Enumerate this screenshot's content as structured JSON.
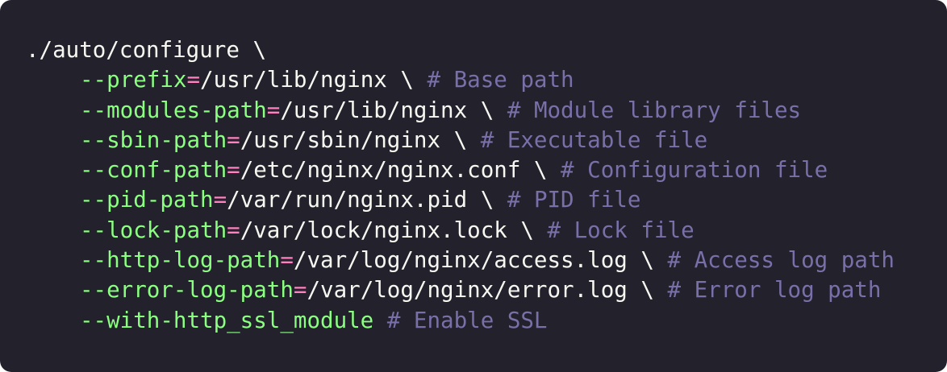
{
  "colors": {
    "background": "#22212c",
    "plain_text": "#f8f8f2",
    "flag": "#8aff80",
    "operator": "#ff80bf",
    "comment": "#7970a9"
  },
  "code": {
    "command": "./auto/configure \\",
    "options": [
      {
        "flag": "--prefix",
        "op": "=",
        "value": "/usr/lib/nginx \\ ",
        "comment": "# Base path"
      },
      {
        "flag": "--modules-path",
        "op": "=",
        "value": "/usr/lib/nginx \\ ",
        "comment": "# Module library files"
      },
      {
        "flag": "--sbin-path",
        "op": "=",
        "value": "/usr/sbin/nginx \\ ",
        "comment": "# Executable file"
      },
      {
        "flag": "--conf-path",
        "op": "=",
        "value": "/etc/nginx/nginx.conf \\ ",
        "comment": "# Configuration file"
      },
      {
        "flag": "--pid-path",
        "op": "=",
        "value": "/var/run/nginx.pid \\ ",
        "comment": "# PID file"
      },
      {
        "flag": "--lock-path",
        "op": "=",
        "value": "/var/lock/nginx.lock \\ ",
        "comment": "# Lock file"
      },
      {
        "flag": "--http-log-path",
        "op": "=",
        "value": "/var/log/nginx/access.log \\ ",
        "comment": "# Access log path"
      },
      {
        "flag": "--error-log-path",
        "op": "=",
        "value": "/var/log/nginx/error.log \\ ",
        "comment": "# Error log path"
      },
      {
        "flag": "--with-http_ssl_module",
        "op": "",
        "value": " ",
        "comment": "# Enable SSL"
      }
    ]
  }
}
